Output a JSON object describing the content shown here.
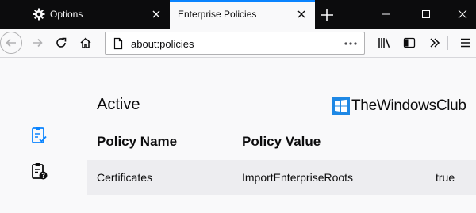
{
  "tabs": [
    {
      "label": "Options",
      "icon": "gear-icon",
      "active": false
    },
    {
      "label": "Enterprise Policies",
      "active": true
    }
  ],
  "navbar": {
    "url": "about:policies"
  },
  "page": {
    "heading": "Active",
    "columns": [
      "Policy Name",
      "Policy Value"
    ],
    "rows": [
      {
        "name": "Certificates",
        "value": "ImportEnterpriseRoots",
        "extra": "true"
      }
    ]
  },
  "watermark": {
    "text": "TheWindowsClub"
  },
  "colors": {
    "tabstrip": "#0c0c0d",
    "accent": "#0a84ff",
    "row_bg": "#ededf0"
  }
}
